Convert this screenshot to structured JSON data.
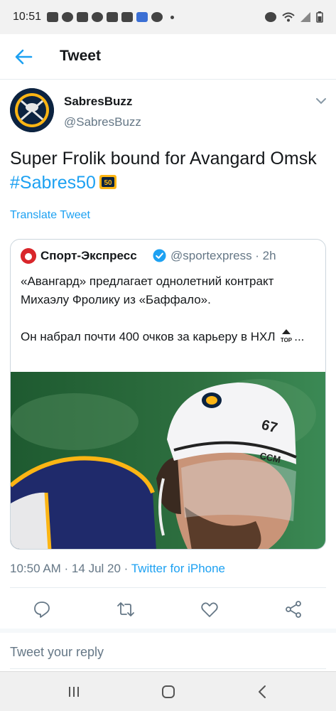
{
  "status_bar": {
    "time": "10:51"
  },
  "header": {
    "title": "Tweet"
  },
  "tweet": {
    "author_name": "SabresBuzz",
    "author_handle": "@SabresBuzz",
    "text_plain": "Super Frolik bound for Avangard Omsk ",
    "hashtag": "#Sabres50",
    "translate_label": "Translate Tweet"
  },
  "quoted": {
    "name": "Спорт-Экспресс",
    "meta": "@sportexpress · 2h",
    "text": "«Авангард» предлагает однолетний контракт Михаэлу Фролику из «Баффало».\n\nОн набрал почти 400 очков за карьеру в НХЛ ",
    "ellipsis": "..."
  },
  "timestamp": {
    "time": "10:50 AM · 14 Jul 20 · ",
    "source": "Twitter for iPhone"
  },
  "actions": [
    "reply-icon",
    "retweet-icon",
    "like-icon",
    "share-icon"
  ],
  "reply": {
    "placeholder": "Tweet your reply"
  },
  "colors": {
    "accent": "#1da1f2",
    "secondary_text": "#657786",
    "border": "#e6ecf0"
  }
}
